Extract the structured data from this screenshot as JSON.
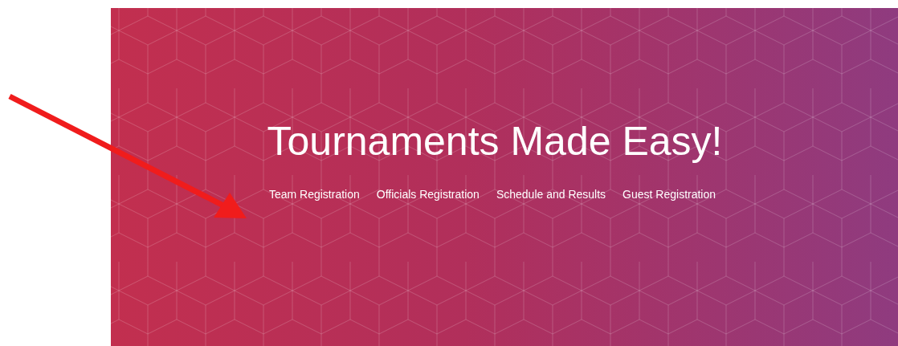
{
  "hero": {
    "title": "Tournaments Made Easy!",
    "links": [
      {
        "label": "Team Registration"
      },
      {
        "label": "Officials Registration"
      },
      {
        "label": "Schedule and Results"
      },
      {
        "label": "Guest Registration"
      }
    ]
  }
}
